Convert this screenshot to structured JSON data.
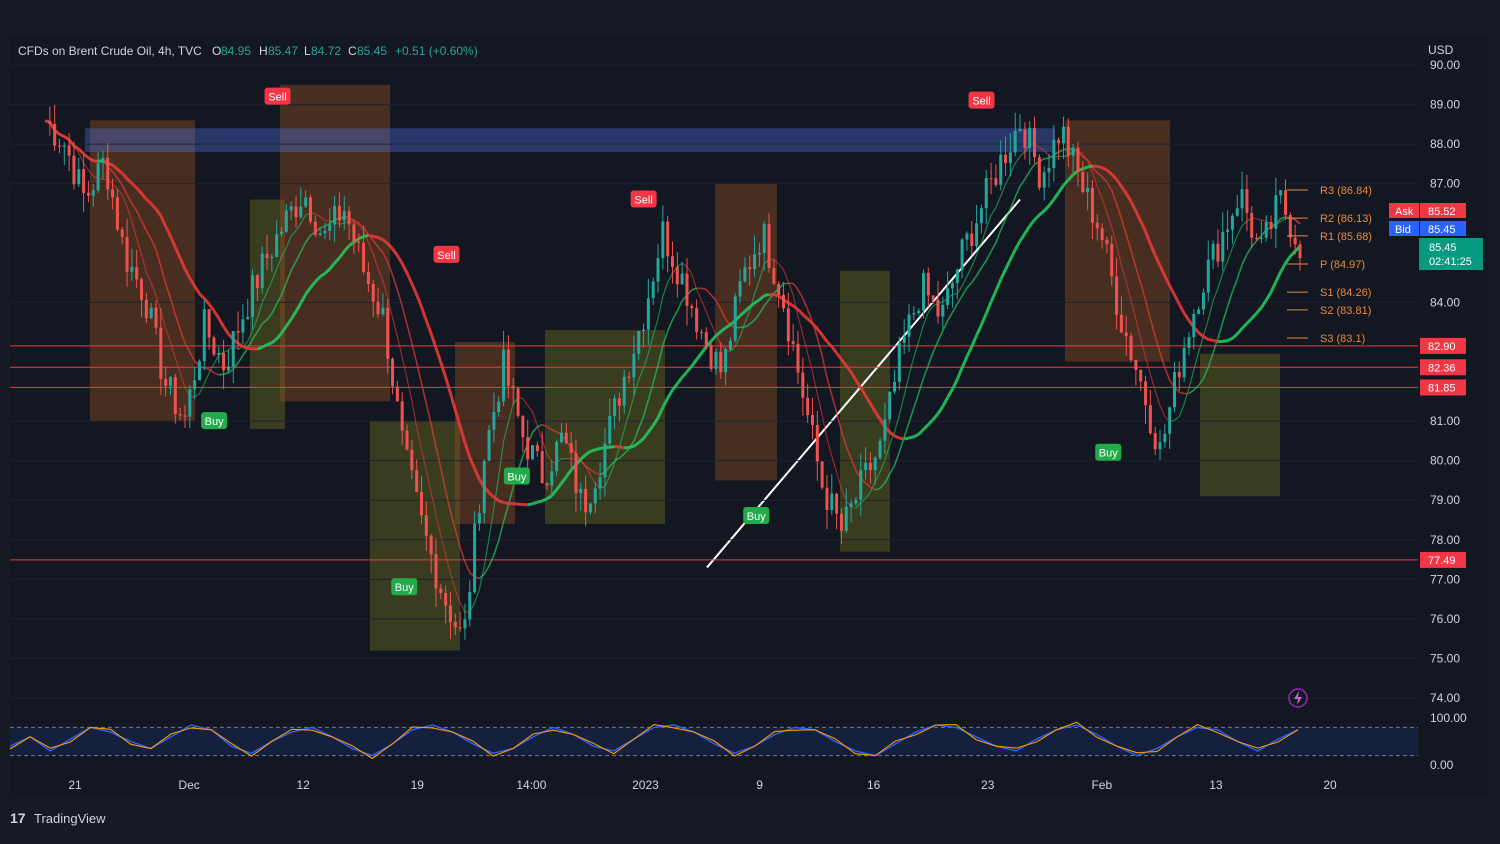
{
  "header": {
    "symbol": "CFDs on Brent Crude Oil, 4h, TVC",
    "o_label": "O",
    "o_value": "84.95",
    "h_label": "H",
    "h_value": "85.47",
    "l_label": "L",
    "l_value": "84.72",
    "c_label": "C",
    "c_value": "85.45",
    "change": "+0.51 (+0.60%)"
  },
  "branding": {
    "logo_text": "TradingView"
  },
  "colors": {
    "up": "#26a69a",
    "down": "#ef5350",
    "bg": "#161a25",
    "accent_green": "#22ab4a",
    "accent_red": "#f23645",
    "orange": "#e8893a"
  },
  "chart_data": {
    "type": "candlestick",
    "currency": "USD",
    "x_ticks": [
      "21",
      "Dec",
      "12",
      "19",
      "14:00",
      "2023",
      "9",
      "16",
      "23",
      "Feb",
      "13",
      "20"
    ],
    "y_ticks": [
      "90.00",
      "89.00",
      "88.00",
      "87.00",
      "84.00",
      "81.00",
      "80.00",
      "79.00",
      "78.00",
      "77.00",
      "76.00",
      "75.00",
      "74.00"
    ],
    "ylim": [
      74,
      90
    ],
    "price_path": [
      88.6,
      88.0,
      86.6,
      87.6,
      85.2,
      84.2,
      82.0,
      81.0,
      83.4,
      82.4,
      83.8,
      85.0,
      86.0,
      86.8,
      85.6,
      86.4,
      84.8,
      83.6,
      80.2,
      78.2,
      76.6,
      75.4,
      80.0,
      82.4,
      80.6,
      79.6,
      80.6,
      78.8,
      80.2,
      82.0,
      83.6,
      85.8,
      84.6,
      83.2,
      82.2,
      84.6,
      85.8,
      84.2,
      81.8,
      79.4,
      78.2,
      79.4,
      80.4,
      82.8,
      84.4,
      83.6,
      85.2,
      86.4,
      87.6,
      88.6,
      87.2,
      88.4,
      87.0,
      85.8,
      83.6,
      82.0,
      80.2,
      82.6,
      84.4,
      85.6,
      86.8,
      85.2,
      86.6,
      85.45
    ],
    "horizontal_levels": [
      {
        "label": "82.90",
        "value": 82.9
      },
      {
        "label": "82.36",
        "value": 82.36
      },
      {
        "label": "81.85",
        "value": 81.85
      },
      {
        "label": "77.49",
        "value": 77.49
      }
    ],
    "pivot_levels": [
      {
        "label": "R3 (86.84)",
        "value": 86.84
      },
      {
        "label": "R2 (86.13)",
        "value": 86.13
      },
      {
        "label": "R1 (85.68)",
        "value": 85.68
      },
      {
        "label": "P (84.97)",
        "value": 84.97
      },
      {
        "label": "S1 (84.26)",
        "value": 84.26
      },
      {
        "label": "S2 (83.81)",
        "value": 83.81
      },
      {
        "label": "S3 (83.1)",
        "value": 83.1
      }
    ],
    "ask": {
      "label": "Ask",
      "value": "85.52"
    },
    "bid": {
      "label": "Bid",
      "value": "85.45"
    },
    "last": {
      "value": "85.45",
      "countdown": "02:41:25"
    },
    "signals": [
      {
        "label": "Sell",
        "x_frac": 0.19,
        "price": 89.2
      },
      {
        "label": "Buy",
        "x_frac": 0.145,
        "price": 81.0
      },
      {
        "label": "Buy",
        "x_frac": 0.28,
        "price": 76.8
      },
      {
        "label": "Sell",
        "x_frac": 0.31,
        "price": 85.2
      },
      {
        "label": "Buy",
        "x_frac": 0.36,
        "price": 79.6
      },
      {
        "label": "Sell",
        "x_frac": 0.45,
        "price": 86.6
      },
      {
        "label": "Buy",
        "x_frac": 0.53,
        "price": 78.6
      },
      {
        "label": "Sell",
        "x_frac": 0.69,
        "price": 89.1
      },
      {
        "label": "Buy",
        "x_frac": 0.78,
        "price": 80.2
      }
    ],
    "oscillator": {
      "y_ticks": [
        "100.00",
        "0.00"
      ],
      "values": [
        40,
        60,
        30,
        55,
        80,
        70,
        50,
        35,
        60,
        85,
        75,
        40,
        25,
        50,
        70,
        80,
        60,
        35,
        20,
        45,
        75,
        85,
        70,
        45,
        25,
        35,
        60,
        80,
        65,
        40,
        30,
        55,
        80,
        85,
        70,
        45,
        25,
        40,
        65,
        80,
        75,
        50,
        30,
        20,
        45,
        70,
        85,
        80,
        60,
        40,
        30,
        55,
        75,
        85,
        65,
        40,
        20,
        35,
        60,
        80,
        75,
        50,
        30,
        55,
        75
      ]
    }
  }
}
